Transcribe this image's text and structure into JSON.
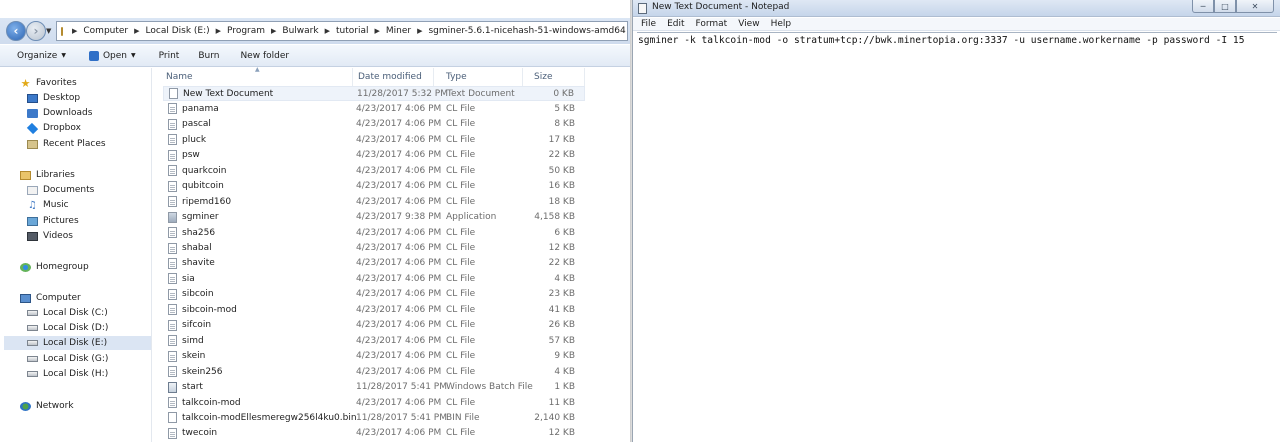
{
  "explorer": {
    "breadcrumbs": [
      "Computer",
      "Local Disk (E:)",
      "Program",
      "Bulwark",
      "tutorial",
      "Miner",
      "sgminer-5.6.1-nicehash-51-windows-amd64"
    ],
    "toolbar": {
      "organize": "Organize",
      "open": "Open",
      "print": "Print",
      "burn": "Burn",
      "new_folder": "New folder"
    },
    "nav": {
      "favorites": "Favorites",
      "desktop": "Desktop",
      "downloads": "Downloads",
      "dropbox": "Dropbox",
      "recent": "Recent Places",
      "libraries": "Libraries",
      "documents": "Documents",
      "music": "Music",
      "pictures": "Pictures",
      "videos": "Videos",
      "homegroup": "Homegroup",
      "computer": "Computer",
      "drive_c": "Local Disk (C:)",
      "drive_d": "Local Disk (D:)",
      "drive_e": "Local Disk (E:)",
      "drive_g": "Local Disk (G:)",
      "drive_h": "Local Disk (H:)",
      "network": "Network"
    },
    "columns": {
      "name": "Name",
      "date": "Date modified",
      "type": "Type",
      "size": "Size"
    },
    "files": [
      {
        "name": "New Text Document",
        "date": "11/28/2017 5:32 PM",
        "type": "Text Document",
        "size": "0 KB"
      },
      {
        "name": "panama",
        "date": "4/23/2017 4:06 PM",
        "type": "CL File",
        "size": "5 KB"
      },
      {
        "name": "pascal",
        "date": "4/23/2017 4:06 PM",
        "type": "CL File",
        "size": "8 KB"
      },
      {
        "name": "pluck",
        "date": "4/23/2017 4:06 PM",
        "type": "CL File",
        "size": "17 KB"
      },
      {
        "name": "psw",
        "date": "4/23/2017 4:06 PM",
        "type": "CL File",
        "size": "22 KB"
      },
      {
        "name": "quarkcoin",
        "date": "4/23/2017 4:06 PM",
        "type": "CL File",
        "size": "50 KB"
      },
      {
        "name": "qubitcoin",
        "date": "4/23/2017 4:06 PM",
        "type": "CL File",
        "size": "16 KB"
      },
      {
        "name": "ripemd160",
        "date": "4/23/2017 4:06 PM",
        "type": "CL File",
        "size": "18 KB"
      },
      {
        "name": "sgminer",
        "date": "4/23/2017 9:38 PM",
        "type": "Application",
        "size": "4,158 KB"
      },
      {
        "name": "sha256",
        "date": "4/23/2017 4:06 PM",
        "type": "CL File",
        "size": "6 KB"
      },
      {
        "name": "shabal",
        "date": "4/23/2017 4:06 PM",
        "type": "CL File",
        "size": "12 KB"
      },
      {
        "name": "shavite",
        "date": "4/23/2017 4:06 PM",
        "type": "CL File",
        "size": "22 KB"
      },
      {
        "name": "sia",
        "date": "4/23/2017 4:06 PM",
        "type": "CL File",
        "size": "4 KB"
      },
      {
        "name": "sibcoin",
        "date": "4/23/2017 4:06 PM",
        "type": "CL File",
        "size": "23 KB"
      },
      {
        "name": "sibcoin-mod",
        "date": "4/23/2017 4:06 PM",
        "type": "CL File",
        "size": "41 KB"
      },
      {
        "name": "sifcoin",
        "date": "4/23/2017 4:06 PM",
        "type": "CL File",
        "size": "26 KB"
      },
      {
        "name": "simd",
        "date": "4/23/2017 4:06 PM",
        "type": "CL File",
        "size": "57 KB"
      },
      {
        "name": "skein",
        "date": "4/23/2017 4:06 PM",
        "type": "CL File",
        "size": "9 KB"
      },
      {
        "name": "skein256",
        "date": "4/23/2017 4:06 PM",
        "type": "CL File",
        "size": "4 KB"
      },
      {
        "name": "start",
        "date": "11/28/2017 5:41 PM",
        "type": "Windows Batch File",
        "size": "1 KB"
      },
      {
        "name": "talkcoin-mod",
        "date": "4/23/2017 4:06 PM",
        "type": "CL File",
        "size": "11 KB"
      },
      {
        "name": "talkcoin-modEllesmeregw256l4ku0.bin",
        "date": "11/28/2017 5:41 PM",
        "type": "BIN File",
        "size": "2,140 KB"
      },
      {
        "name": "twecoin",
        "date": "4/23/2017 4:06 PM",
        "type": "CL File",
        "size": "12 KB"
      }
    ]
  },
  "notepad": {
    "title": "New Text Document - Notepad",
    "menu": [
      "File",
      "Edit",
      "Format",
      "View",
      "Help"
    ],
    "content": "sgminer -k talkcoin-mod -o stratum+tcp://bwk.minertopia.org:3337 -u username.workername -p password -I 15"
  }
}
